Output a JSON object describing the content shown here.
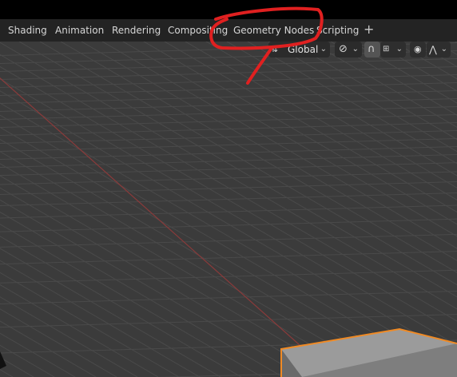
{
  "workspace_tabs": [
    {
      "label": "Shading"
    },
    {
      "label": "Animation"
    },
    {
      "label": "Rendering"
    },
    {
      "label": "Compositing"
    },
    {
      "label": "Geometry Nodes"
    },
    {
      "label": "Scripting"
    }
  ],
  "add_workspace_label": "+",
  "header": {
    "transform_orientation": "Global"
  },
  "icons": {
    "orientation": "transform-orientation-icon",
    "pivot": "pivot-link-icon",
    "snap": "snap-magnet-icon",
    "snap_increment": "snap-increment-icon",
    "proportional": "proportional-editing-icon",
    "falloff": "falloff-curve-icon"
  },
  "colors": {
    "tab_bar": "#232323",
    "viewport": "#3b3b3b",
    "grid_line": "#4a4a4a",
    "x_axis": "#8a3a3a",
    "selection_outline": "#f08a24",
    "annotation": "#e02020"
  }
}
